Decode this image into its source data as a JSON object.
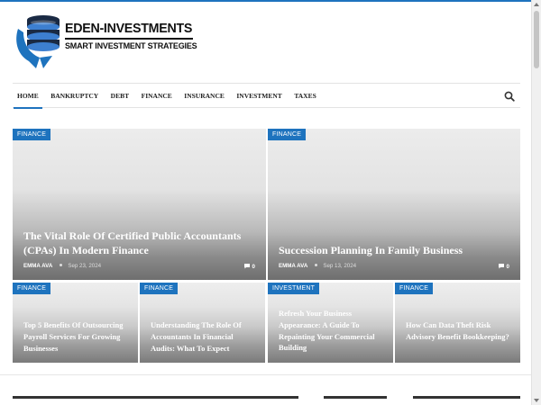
{
  "site": {
    "logo_title": "EDEN-INVESTMENTS",
    "logo_subtitle": "SMART INVESTMENT STRATEGIES",
    "accent_color": "#1e73be"
  },
  "nav": {
    "items": [
      {
        "label": "HOME",
        "active": true
      },
      {
        "label": "BANKRUPTCY",
        "active": false
      },
      {
        "label": "DEBT",
        "active": false
      },
      {
        "label": "FINANCE",
        "active": false
      },
      {
        "label": "INSURANCE",
        "active": false
      },
      {
        "label": "INVESTMENT",
        "active": false
      },
      {
        "label": "TAXES",
        "active": false
      }
    ],
    "search_icon": "search-icon"
  },
  "featured": [
    {
      "category": "FINANCE",
      "title": "The Vital Role Of Certified Public Accountants (CPAs) In Modern Finance",
      "author": "EMMA AVA",
      "date": "Sep 23, 2024",
      "comments": "0"
    },
    {
      "category": "FINANCE",
      "title": "Succession Planning In Family Business",
      "author": "EMMA AVA",
      "date": "Sep 13, 2024",
      "comments": "0"
    }
  ],
  "grid": [
    {
      "category": "FINANCE",
      "title": "Top 5 Benefits Of Outsourcing Payroll Services For Growing Businesses"
    },
    {
      "category": "FINANCE",
      "title": "Understanding The Role Of Accountants In Financial Audits: What To Expect"
    },
    {
      "category": "INVESTMENT",
      "title": "Refresh Your Business Appearance: A Guide To Repainting Your Commercial Building"
    },
    {
      "category": "FINANCE",
      "title": "How Can Data Theft Risk Advisory Benefit Bookkeeping?"
    }
  ]
}
